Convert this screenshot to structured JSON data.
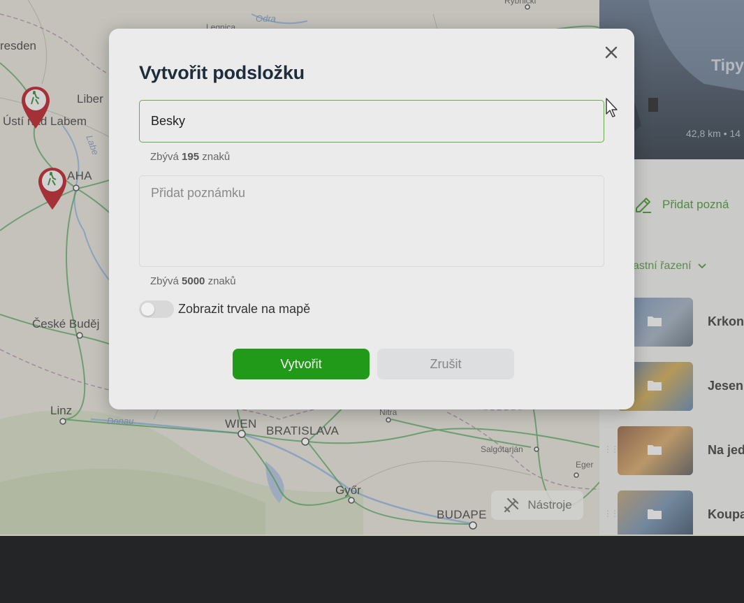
{
  "map": {
    "cities": [
      {
        "id": "dresden",
        "label": "resden"
      },
      {
        "id": "liberec",
        "label": "Liber"
      },
      {
        "id": "usti",
        "label": "Ústí nad Labem"
      },
      {
        "id": "praha",
        "label": "AHA"
      },
      {
        "id": "budejovice",
        "label": "České Buděj"
      },
      {
        "id": "linz",
        "label": "Linz"
      },
      {
        "id": "wien",
        "label": "WIEN"
      },
      {
        "id": "bratislava",
        "label": "BRATISLAVA"
      },
      {
        "id": "gyor",
        "label": "Győr"
      },
      {
        "id": "budapest",
        "label": "BUDAPE"
      },
      {
        "id": "legnica",
        "label": "Legnica"
      },
      {
        "id": "nitra",
        "label": "Nitra"
      },
      {
        "id": "salgotarjan",
        "label": "Salgótarján"
      },
      {
        "id": "eger",
        "label": "Eger"
      },
      {
        "id": "rybarski",
        "label": "Rybnicki"
      }
    ],
    "rivers": [
      {
        "id": "odra",
        "label": "Odra"
      },
      {
        "id": "labe",
        "label": "Labe"
      },
      {
        "id": "donau",
        "label": "Donau"
      }
    ],
    "tools_label": "Nástroje"
  },
  "panel": {
    "hero_title": "Tipy",
    "hero_meta": "42,8 km • 14",
    "add_note_label": "Přidat pozná",
    "sort_label": "astní řazení",
    "folders": [
      {
        "name": "Krkon"
      },
      {
        "name": "Jesen"
      },
      {
        "name": "Na jed"
      },
      {
        "name": "Koupa"
      }
    ]
  },
  "dialog": {
    "title": "Vytvořit podsložku",
    "name_value": "Besky",
    "name_counter_prefix": "Zbývá",
    "name_counter_value": "195",
    "name_counter_suffix": "znaků",
    "note_placeholder": "Přidat poznámku",
    "note_counter_prefix": "Zbývá",
    "note_counter_value": "5000",
    "note_counter_suffix": "znaků",
    "toggle_label": "Zobrazit trvale na mapě",
    "toggle_on": false,
    "create_label": "Vytvořit",
    "cancel_label": "Zrušit"
  },
  "colors": {
    "accent_green": "#229a19",
    "input_border_focus": "#6aa84f",
    "title_color": "#1e2d3c",
    "pin_red": "#b3131c"
  }
}
